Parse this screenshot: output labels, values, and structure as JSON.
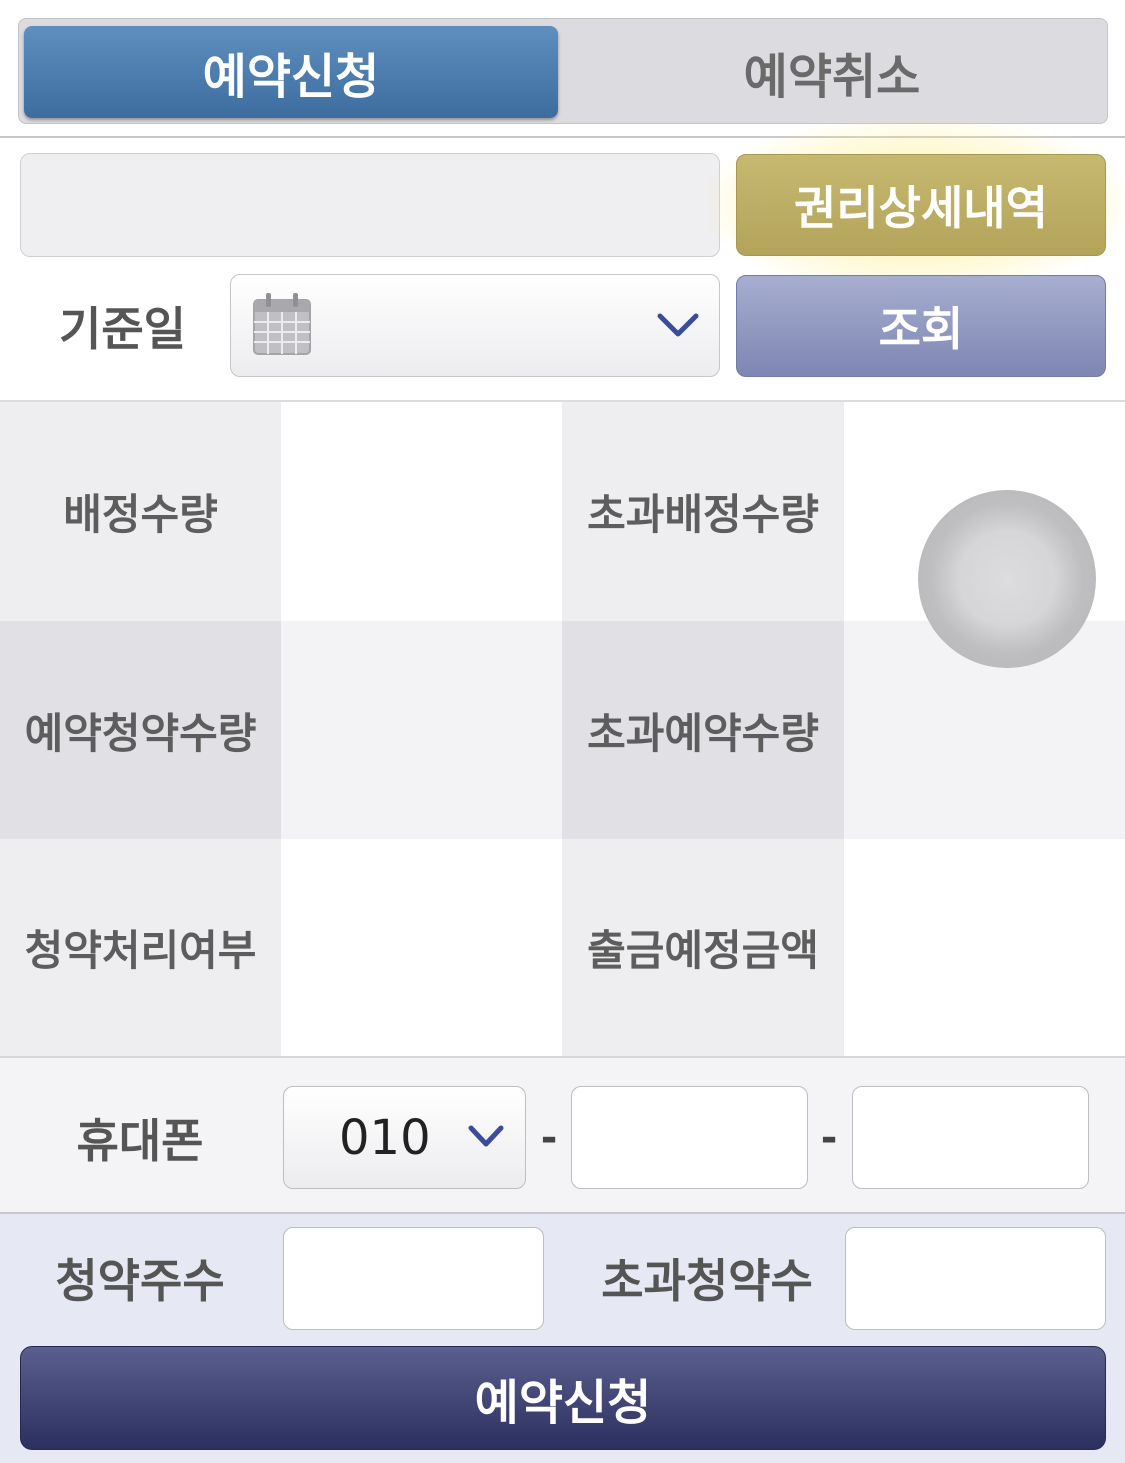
{
  "tabs": {
    "apply": "예약신청",
    "cancel": "예약취소"
  },
  "search": {
    "account_value": "",
    "rights_button": "권리상세내역",
    "date_label": "기준일",
    "date_value": "",
    "query_button": "조회"
  },
  "grid": {
    "r1": {
      "l1": "배정수량",
      "v1": "",
      "l2": "초과배정수량",
      "v2": ""
    },
    "r2": {
      "l1": "예약청약수량",
      "v1": "",
      "l2": "초과예약수량",
      "v2": ""
    },
    "r3": {
      "l1": "청약처리여부",
      "v1": "",
      "l2": "출금예정금액",
      "v2": ""
    }
  },
  "phone": {
    "label": "휴대폰",
    "prefix": "010",
    "dash": "-",
    "mid": "",
    "last": ""
  },
  "subscription": {
    "shares_label": "청약주수",
    "shares_value": "",
    "excess_label": "초과청약수",
    "excess_value": "",
    "submit_button": "예약신청"
  },
  "colors": {
    "tab_active": "#4a7aab",
    "rights_button": "#bcad63",
    "query_button": "#8d95c0",
    "submit_button": "#3d4272"
  },
  "icons": [
    "calendar-icon",
    "chevron-down-icon",
    "floating-assistive-touch"
  ]
}
